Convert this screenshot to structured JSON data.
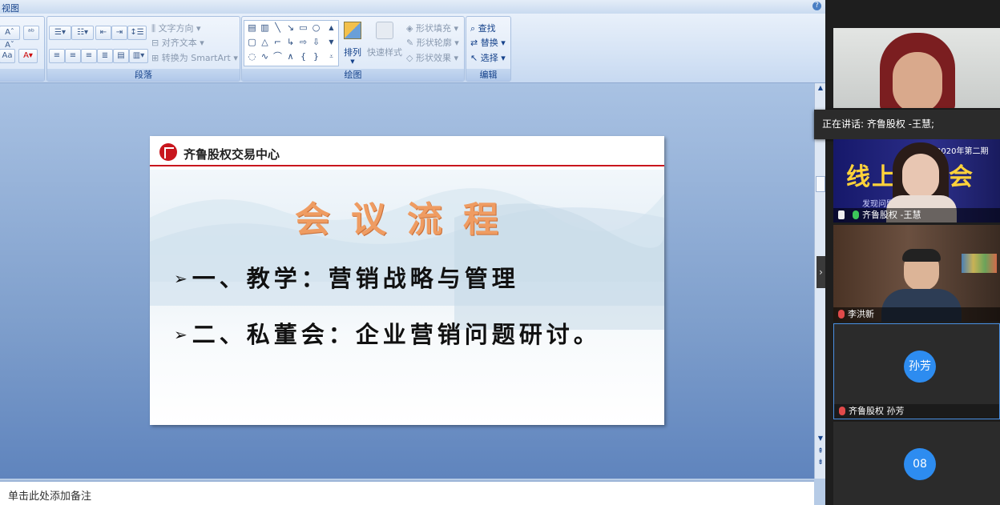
{
  "ppt": {
    "tab_label": "视图",
    "help_icon": "?",
    "groups": {
      "paragraph": {
        "label": "段落",
        "text_direction": "文字方向",
        "align_text": "对齐文本",
        "convert_smartart": "转换为 SmartArt"
      },
      "drawing": {
        "label": "绘图",
        "arrange": "排列",
        "quick_styles": "快速样式",
        "shape_fill": "形状填充",
        "shape_outline": "形状轮廓",
        "shape_effects": "形状效果"
      },
      "editing": {
        "label": "编辑",
        "find": "查找",
        "replace": "替换",
        "select": "选择"
      }
    },
    "notes_placeholder": "单击此处添加备注"
  },
  "slide": {
    "org_name": "齐鲁股权交易中心",
    "title": "会议流程",
    "bullets": [
      "一、教学：营销战略与管理",
      "二、私董会：企业营销问题研讨。"
    ],
    "accent_color": "#c8161d",
    "title_color": "#ef9c62"
  },
  "meeting": {
    "speaking_banner": "正在讲话: 齐鲁股权 -王慧;",
    "participants": [
      {
        "name": "齐鲁股权 -王慧",
        "background_text_1": "2020年第二期",
        "background_text_2": "线上私董会",
        "background_text_3": "发现问题 解决问题"
      },
      {
        "name": "李洪新"
      },
      {
        "name": "齐鲁股权 孙芳",
        "avatar_text": "孙芳"
      },
      {
        "name": "",
        "avatar_text": "08"
      }
    ]
  }
}
